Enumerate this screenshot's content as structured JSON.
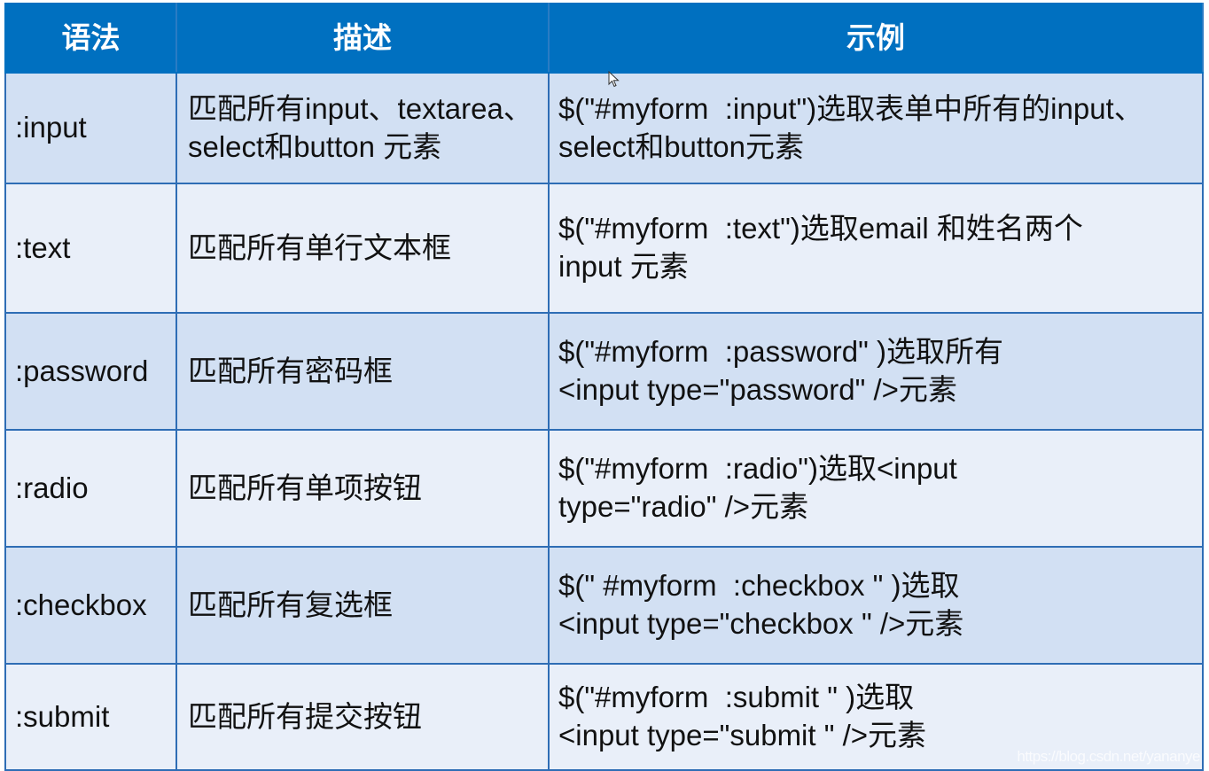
{
  "table": {
    "headers": [
      "语法",
      "描述",
      "示例"
    ],
    "rows": [
      {
        "syntax": ":input",
        "description": [
          "匹配所有input、textarea、",
          "select和button 元素"
        ],
        "example": [
          "$(\"#myform  :input\")选取表单中所有的input、",
          "select和button元素"
        ]
      },
      {
        "syntax": ":text",
        "description": [
          "匹配所有单行文本框"
        ],
        "example": [
          "$(\"#myform  :text\")选取email 和姓名两个",
          "input 元素"
        ]
      },
      {
        "syntax": ":password",
        "description": [
          "匹配所有密码框"
        ],
        "example": [
          "$(\"#myform  :password\" )选取所有",
          "<input type=\"password\" />元素"
        ]
      },
      {
        "syntax": ":radio",
        "description": [
          "匹配所有单项按钮"
        ],
        "example": [
          "$(\"#myform  :radio\")选取<input",
          "type=\"radio\" />元素"
        ]
      },
      {
        "syntax": ":checkbox",
        "description": [
          "匹配所有复选框"
        ],
        "example": [
          "$(\" #myform  :checkbox \" )选取",
          "<input type=\"checkbox \" />元素"
        ]
      },
      {
        "syntax": ":submit",
        "description": [
          "匹配所有提交按钮"
        ],
        "example": [
          "$(\"#myform  :submit \" )选取",
          "<input type=\"submit \" />元素"
        ]
      }
    ]
  },
  "watermark": "https://blog.csdn.net/yananye",
  "colors": {
    "header_bg": "#0070C0",
    "row_odd_bg": "#D2E0F3",
    "row_even_bg": "#E9EFF9",
    "border": "#2E6DB5"
  }
}
